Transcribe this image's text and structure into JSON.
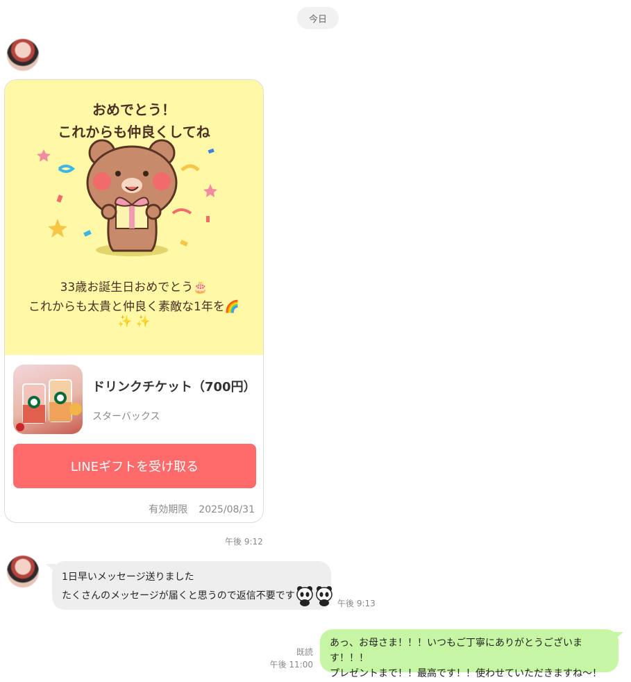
{
  "date_divider": "今日",
  "gift_card": {
    "illustration_text": {
      "line1": "おめでとう！",
      "line2": "これからも仲良くしてね"
    },
    "message": {
      "line1": "33歳お誕生日おめでとう🎂",
      "line2": "これからも太貴と仲良く素敵な1年を🌈",
      "line3": "✨ ✨"
    },
    "product": {
      "title": "ドリンクチケット（700円）",
      "brand": "スターバックス"
    },
    "button_label": "LINEギフトを受け取る",
    "expiry_label": "有効期限",
    "expiry_date": "2025/08/31"
  },
  "gift_time": "午後 9:12",
  "incoming_message": {
    "line1": "1日早いメッセージ送りました",
    "line2": "たくさんのメッセージが届くと思うので返信不要です",
    "time": "午後 9:13"
  },
  "outgoing_message": {
    "line1": "あっ、お母さま！！！いつもご丁寧にありがとうございます！！！",
    "line2": "プレゼントまで！！最高です！！使わせていただきますね〜！",
    "read_label": "既読",
    "time": "午後 11:00"
  },
  "colors": {
    "card_yellow": "#fef8a7",
    "button_red": "#ff6b6b",
    "incoming_bubble": "#eeeeee",
    "outgoing_bubble": "#c6f5a3"
  },
  "icons": {
    "sticker": "teddy-bear-gift-sticker",
    "panda": "panda-emoji"
  }
}
